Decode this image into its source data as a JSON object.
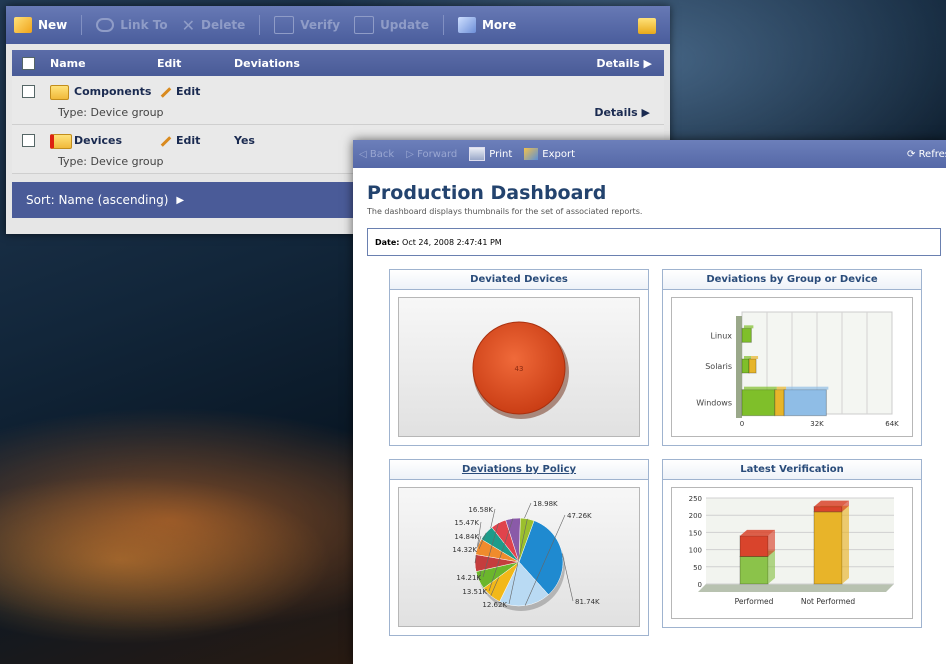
{
  "back_window": {
    "toolbar": {
      "new": "New",
      "link_to": "Link To",
      "delete": "Delete",
      "verify": "Verify",
      "update": "Update",
      "more": "More"
    },
    "table": {
      "headers": {
        "name": "Name",
        "edit": "Edit",
        "deviations": "Deviations",
        "details": "Details"
      },
      "rows": [
        {
          "name": "Components",
          "edit": "Edit",
          "deviations": "",
          "type": "Type: Device group",
          "details": "Details"
        },
        {
          "name": "Devices",
          "edit": "Edit",
          "deviations": "Yes",
          "type": "Type: Device group",
          "details": ""
        }
      ]
    },
    "sort_label": "Sort: Name (ascending)"
  },
  "front_window": {
    "toolbar": {
      "back": "Back",
      "forward": "Forward",
      "print": "Print",
      "export": "Export",
      "refresh": "Refres"
    },
    "title": "Production Dashboard",
    "description": "The dashboard displays thumbnails for the set of associated reports.",
    "date_label": "Date:",
    "date_value": "Oct 24, 2008 2:47:41 PM",
    "panels": {
      "deviated_devices": "Deviated Devices",
      "by_group": "Deviations by Group or Device",
      "by_policy": "Deviations by Policy",
      "latest_verification": "Latest Verification"
    }
  },
  "colors": {
    "toolbar": "#5568a7",
    "panel_title": "#2a4c7a",
    "pie_red": "#e0481c"
  },
  "chart_data": [
    {
      "type": "pie",
      "title": "Deviated Devices",
      "labels": [
        "43"
      ],
      "values": [
        43
      ],
      "colors": [
        "#e0481c"
      ]
    },
    {
      "type": "bar",
      "title": "Deviations by Group or Device",
      "orientation": "horizontal",
      "stacked": true,
      "categories": [
        "Linux",
        "Solaris",
        "Windows"
      ],
      "series": [
        {
          "values": [
            4000,
            3000,
            14000
          ],
          "color": "#7fbf2a"
        },
        {
          "values": [
            0,
            3000,
            4000
          ],
          "color": "#e7b52a"
        },
        {
          "values": [
            0,
            0,
            18000
          ],
          "color": "#8fbde6"
        }
      ],
      "x_ticks": [
        "0",
        "32K",
        "64K"
      ],
      "xlim": [
        0,
        64000
      ]
    },
    {
      "type": "pie",
      "title": "Deviations by Policy",
      "labels": [
        "81.74K",
        "47.26K",
        "18.98K",
        "16.58K",
        "15.47K",
        "14.84K",
        "14.32K",
        "14.21K",
        "13.51K",
        "12.62K"
      ],
      "values": [
        81.74,
        47.26,
        18.98,
        16.58,
        15.47,
        14.84,
        14.32,
        14.21,
        13.51,
        12.62
      ],
      "colors": [
        "#1f8ad0",
        "#b9daf3",
        "#f2b819",
        "#6bb62c",
        "#c43d3d",
        "#f08b2c",
        "#1e9c8a",
        "#e0434c",
        "#8a5aa8",
        "#9bbf2d"
      ]
    },
    {
      "type": "bar",
      "title": "Latest Verification",
      "stacked": true,
      "categories": [
        "Performed",
        "Not Performed"
      ],
      "series": [
        {
          "values": [
            80,
            0
          ],
          "color": "#8bc34a"
        },
        {
          "values": [
            60,
            0
          ],
          "color": "#d9442c"
        },
        {
          "values": [
            0,
            210
          ],
          "color": "#e8b429"
        },
        {
          "values": [
            0,
            15
          ],
          "color": "#d9442c"
        }
      ],
      "y_ticks": [
        "250",
        "200",
        "150",
        "100",
        "50",
        "0"
      ],
      "ylim": [
        0,
        250
      ]
    }
  ]
}
